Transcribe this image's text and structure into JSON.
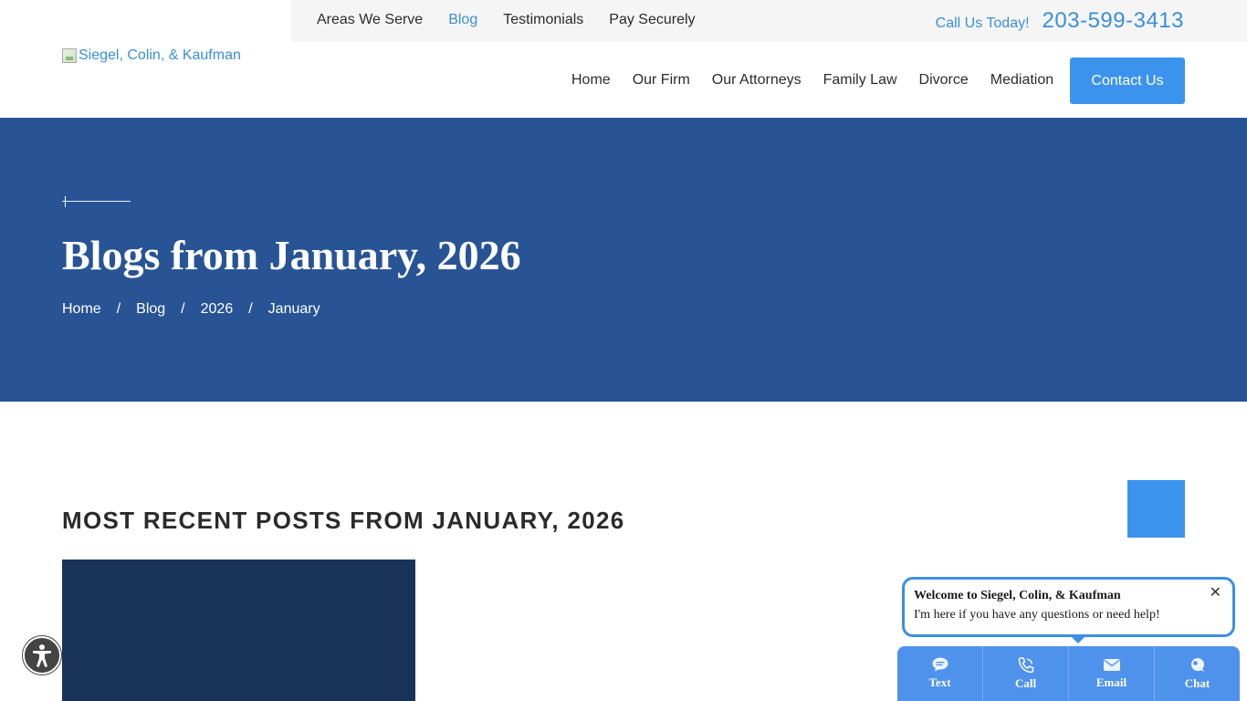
{
  "utility_nav": {
    "items": [
      {
        "label": "Areas We Serve",
        "active": false
      },
      {
        "label": "Blog",
        "active": true
      },
      {
        "label": "Testimonials",
        "active": false
      },
      {
        "label": "Pay Securely",
        "active": false
      }
    ],
    "call_label": "Call Us Today!",
    "phone": "203-599-3413"
  },
  "logo": {
    "alt_text": "Siegel, Colin, & Kaufman"
  },
  "main_nav": {
    "items": [
      "Home",
      "Our Firm",
      "Our Attorneys",
      "Family Law",
      "Divorce",
      "Mediation"
    ],
    "contact_label": "Contact Us"
  },
  "hero": {
    "title": "Blogs from January, 2026",
    "breadcrumb": [
      "Home",
      "Blog",
      "2026",
      "January"
    ],
    "separator": "/"
  },
  "content": {
    "section_heading": "MOST RECENT POSTS FROM JANUARY, 2026"
  },
  "chat": {
    "welcome": "Welcome to Siegel, Colin, & Kaufman",
    "message": "I'm here if you have any questions or need help!",
    "close_glyph": "✕",
    "actions": [
      {
        "label": "Text",
        "icon": "text-bubble-icon"
      },
      {
        "label": "Call",
        "icon": "phone-icon"
      },
      {
        "label": "Email",
        "icon": "envelope-icon"
      },
      {
        "label": "Chat",
        "icon": "chat-icon"
      }
    ]
  },
  "colors": {
    "accent": "#3b93ee",
    "hero_bg": "#285496",
    "card_bg": "#193358",
    "link": "#3b8fd9"
  }
}
